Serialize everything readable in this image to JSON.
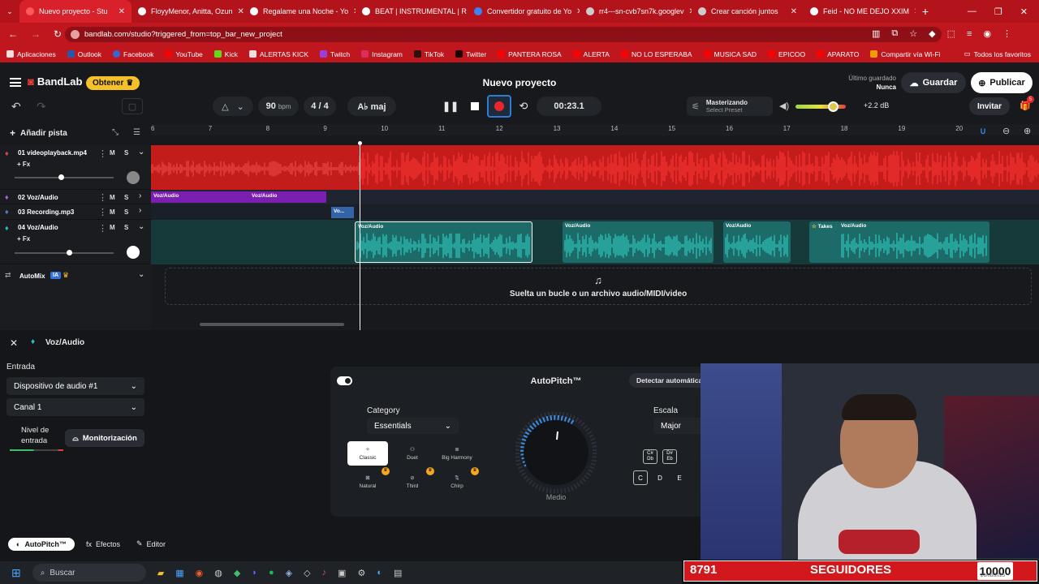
{
  "browser": {
    "tabs": [
      {
        "title": "Nuevo proyecto - Stu",
        "color": "#ff5a5a"
      },
      {
        "title": "FloyyMenor, Anitta, Ozun",
        "color": "#ff0000"
      },
      {
        "title": "Regalame una Noche - Yo",
        "color": "#ff0000"
      },
      {
        "title": "BEAT | INSTRUMENTAL | R",
        "color": "#ff0000"
      },
      {
        "title": "Convertidor gratuito de Yo",
        "color": "#3b82f6"
      },
      {
        "title": "rr4---sn-cvb7sn7k.googlev",
        "color": "#cccccc"
      },
      {
        "title": "Crear canción juntos",
        "color": "#cccccc"
      },
      {
        "title": "Feid - NO ME DEJO XXIM",
        "color": "#ff0000"
      }
    ],
    "url": "bandlab.com/studio?triggered_from=top_bar_new_project",
    "bookmarks": [
      "Aplicaciones",
      "Outlook",
      "Facebook",
      "YouTube",
      "Kick",
      "ALERTAS KICK",
      "Twitch",
      "Instagram",
      "TikTok",
      "Twitter",
      "PANTERA ROSA",
      "ALERTA",
      "NO LO ESPERABA",
      "MUSICA SAD",
      "EPICOO",
      "APARATO",
      "Compartir vía Wi-Fi"
    ],
    "bookmarks_all": "Todos los favoritos"
  },
  "app": {
    "logo": "BandLab",
    "obtener": "Obtener",
    "project_title": "Nuevo proyecto",
    "saved_label": "Último guardado",
    "saved_value": "Nunca",
    "guardar": "Guardar",
    "publicar": "Publicar",
    "invitar": "Invitar",
    "notif_count": "5",
    "bpm_value": "90",
    "bpm_label": "bpm",
    "time_sig": "4 / 4",
    "key": "A♭ maj",
    "time": "00:23.1",
    "mastering_title": "Masterizando",
    "mastering_sub": "Select Preset",
    "volume_db": "+2.2 dB",
    "add_track": "Añadir pista"
  },
  "ruler": [
    "6",
    "7",
    "8",
    "9",
    "10",
    "11",
    "12",
    "13",
    "14",
    "15",
    "16",
    "17",
    "18",
    "19",
    "20"
  ],
  "tracks": [
    {
      "name": "01  videoplayback.mp4",
      "fx": "+ Fx"
    },
    {
      "name": "02  Voz/Audio"
    },
    {
      "name": "03  Recording.mp3"
    },
    {
      "name": "04  Voz/Audio",
      "fx": "+ Fx"
    }
  ],
  "clips": {
    "voz1": "Voz/Audio",
    "voz2": "Voz/Audio",
    "rec": "Vo...",
    "t4a": "Voz/Audio",
    "t4b": "Voz/Audio",
    "t4c": "Voz/Audio",
    "t4d_takes": "Takes",
    "t4d": "Voz/Audio"
  },
  "automix": {
    "label": "AutoMix",
    "badge": "IA"
  },
  "drop_text": "Suelta un bucle o un archivo audio/MIDI/video",
  "panel": {
    "track_title": "Voz/Audio",
    "entrada": "Entrada",
    "device": "Dispositivo de audio #1",
    "channel": "Canal 1",
    "nivel": "Nivel de entrada",
    "monitor": "Monitorización",
    "autopitch_title": "AutoPitch™",
    "detect": "Detectar automática",
    "category_label": "Category",
    "category_value": "Essentials",
    "presets": [
      "Classic",
      "Duet",
      "Big Harmony",
      "Natural",
      "Third",
      "Chirp"
    ],
    "knob_label": "Medio",
    "scale_label": "Escala",
    "scale_value": "Major",
    "keys_top": [
      "C# Db",
      "D# Eb"
    ],
    "keys": [
      "C",
      "D",
      "E"
    ],
    "bottom_tabs": [
      "AutoPitch™",
      "Efectos",
      "Editor"
    ]
  },
  "taskbar": {
    "search": "Buscar"
  },
  "overlay": {
    "count": "8791",
    "label": "SEGUIDORES",
    "goal": "10000",
    "date": "26/08/2025"
  }
}
